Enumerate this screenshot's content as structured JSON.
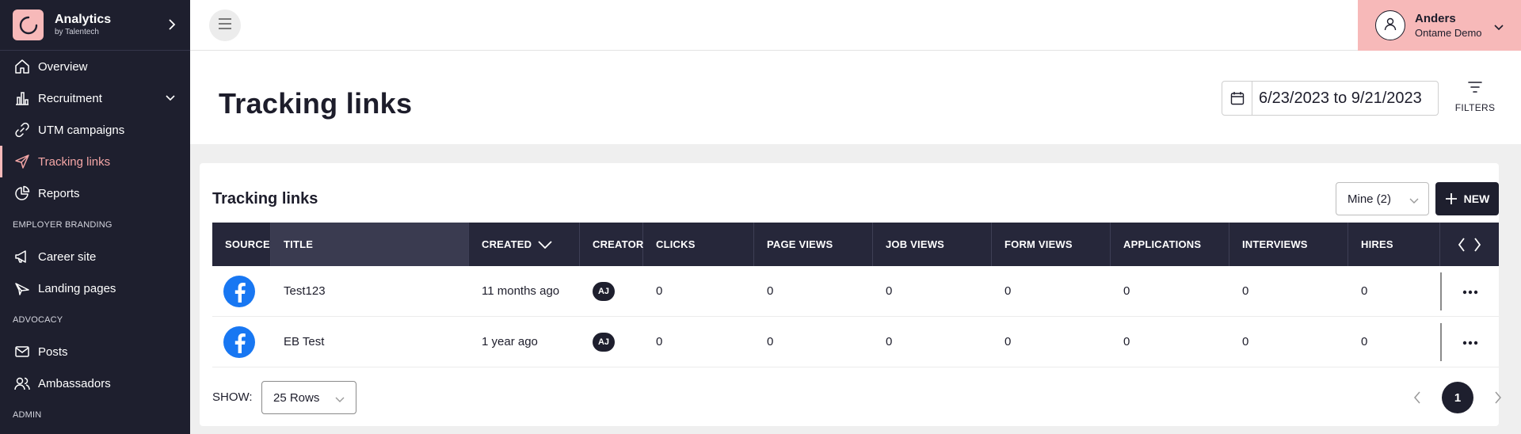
{
  "brand": {
    "title": "Analytics",
    "subtitle": "by Talentech"
  },
  "sidebar": {
    "items": [
      {
        "label": "Overview",
        "icon": "home-icon"
      },
      {
        "label": "Recruitment",
        "icon": "bar-chart-icon"
      },
      {
        "label": "UTM campaigns",
        "icon": "link-icon"
      },
      {
        "label": "Tracking links",
        "icon": "send-icon",
        "active": true
      },
      {
        "label": "Reports",
        "icon": "pie-chart-icon"
      }
    ],
    "section_employer": "EMPLOYER BRANDING",
    "employer_items": [
      {
        "label": "Career site",
        "icon": "megaphone-icon"
      },
      {
        "label": "Landing pages",
        "icon": "paper-plane-icon"
      }
    ],
    "section_advocacy": "ADVOCACY",
    "advocacy_items": [
      {
        "label": "Posts",
        "icon": "mail-icon"
      },
      {
        "label": "Ambassadors",
        "icon": "users-icon"
      }
    ],
    "section_admin": "ADMIN"
  },
  "user": {
    "name": "Anders",
    "org": "Ontame Demo"
  },
  "header": {
    "title": "Tracking links",
    "date_range": "6/23/2023 to 9/21/2023",
    "filters_label": "FILTERS"
  },
  "card": {
    "title": "Tracking links",
    "filter_select": "Mine (2)",
    "new_label": "NEW"
  },
  "table": {
    "columns": [
      "SOURCE",
      "TITLE",
      "CREATED",
      "CREATOR",
      "CLICKS",
      "PAGE VIEWS",
      "JOB VIEWS",
      "FORM VIEWS",
      "APPLICATIONS",
      "INTERVIEWS",
      "HIRES"
    ],
    "rows": [
      {
        "title": "Test123",
        "created": "11 months ago",
        "creator": "AJ",
        "clicks": "0",
        "page_views": "0",
        "job_views": "0",
        "form_views": "0",
        "applications": "0",
        "interviews": "0",
        "hires": "0"
      },
      {
        "title": "EB Test",
        "created": "1 year ago",
        "creator": "AJ",
        "clicks": "0",
        "page_views": "0",
        "job_views": "0",
        "form_views": "0",
        "applications": "0",
        "interviews": "0",
        "hires": "0"
      }
    ]
  },
  "footer": {
    "show_label": "SHOW:",
    "rows_select": "25 Rows",
    "current_page": "1"
  },
  "colors": {
    "sidebar_bg": "#1e1f2e",
    "accent_pink": "#f7b9b9",
    "facebook_blue": "#1877f2"
  }
}
